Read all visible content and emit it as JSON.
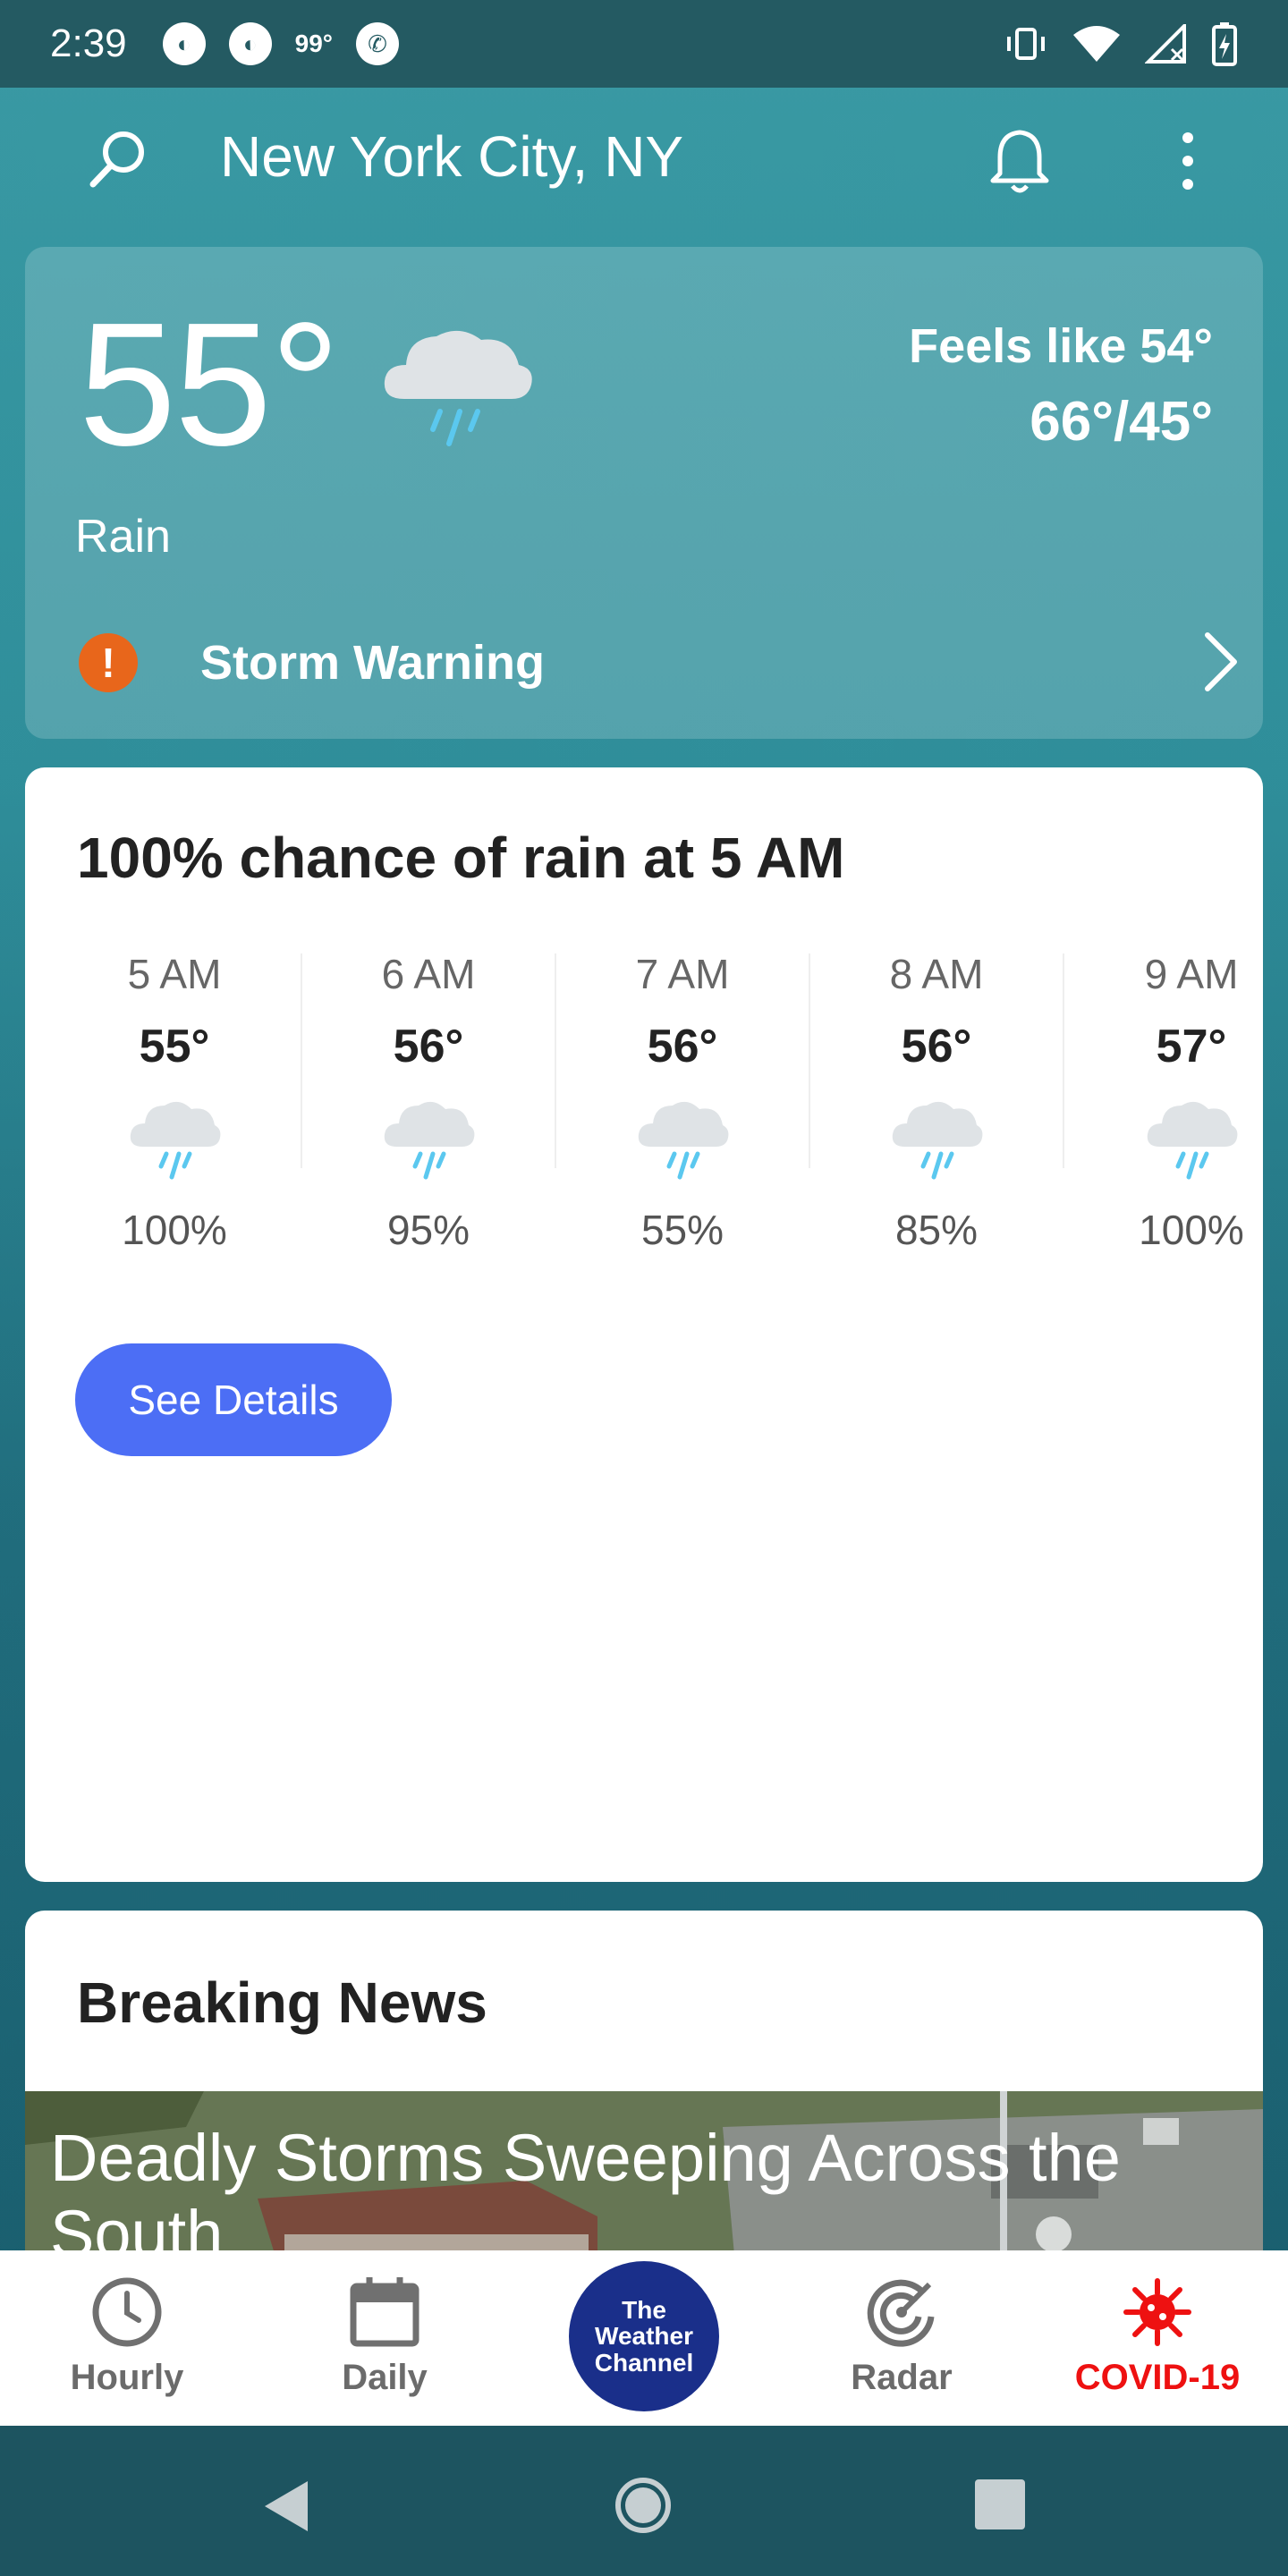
{
  "status_bar": {
    "time": "2:39",
    "temp": "99°",
    "colors": {
      "bg": "#245a62"
    }
  },
  "header": {
    "location": "New York City, NY"
  },
  "current": {
    "temperature": "55°",
    "condition": "Rain",
    "feels_like": "Feels like 54°",
    "hi_lo": "66°/45°",
    "condition_icon": "rain-cloud-icon",
    "alert": {
      "label": "Storm Warning",
      "icon": "exclamation-icon",
      "color": "#e8661b"
    }
  },
  "hourly": {
    "title": "100% chance of rain at 5 AM",
    "hours": [
      {
        "time": "5 AM",
        "temp": "55°",
        "precip": "100%"
      },
      {
        "time": "6 AM",
        "temp": "56°",
        "precip": "95%"
      },
      {
        "time": "7 AM",
        "temp": "56°",
        "precip": "55%"
      },
      {
        "time": "8 AM",
        "temp": "56°",
        "precip": "85%"
      },
      {
        "time": "9 AM",
        "temp": "57°",
        "precip": "100%"
      }
    ],
    "see_details_label": "See Details",
    "button_color": "#4c6ef5"
  },
  "news": {
    "title": "Breaking News",
    "headline": "Deadly Storms Sweeping Across the South"
  },
  "bottom_nav": {
    "items": [
      {
        "label": "Hourly",
        "icon": "clock-icon"
      },
      {
        "label": "Daily",
        "icon": "calendar-icon"
      },
      {
        "label": "Radar",
        "icon": "radar-icon"
      },
      {
        "label": "COVID-19",
        "icon": "virus-icon",
        "color": "#e11111"
      }
    ],
    "logo_line1": "The",
    "logo_line2": "Weather",
    "logo_line3": "Channel"
  }
}
